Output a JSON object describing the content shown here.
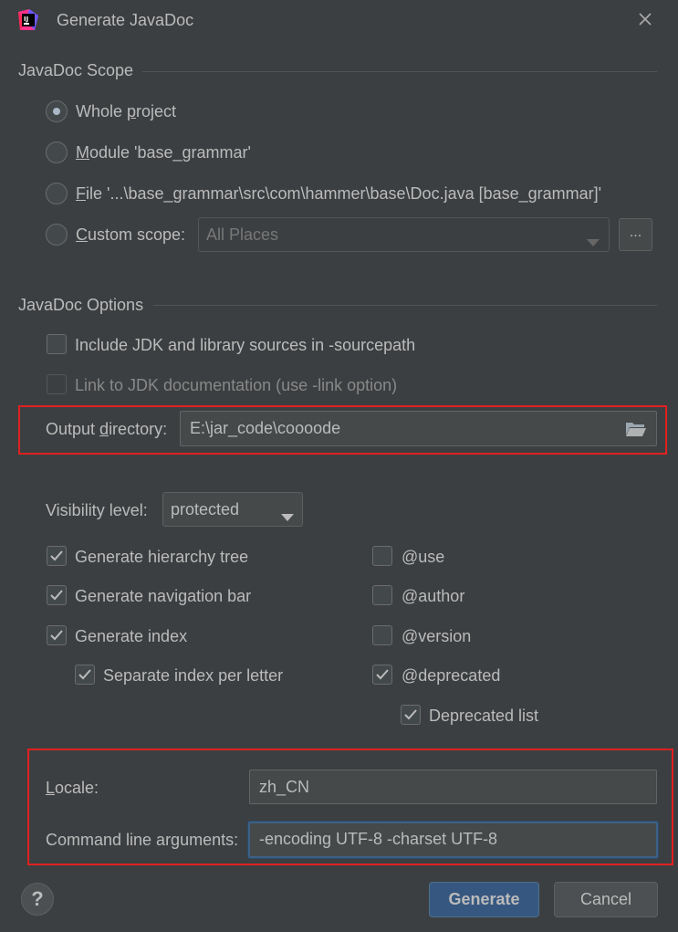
{
  "window": {
    "title": "Generate JavaDoc",
    "logo_icon": "intellij-idea-icon",
    "close_icon": "close-icon"
  },
  "scope": {
    "heading": "JavaDoc Scope",
    "whole_project": {
      "pre": "Whole ",
      "u": "p",
      "post": "roject",
      "selected": true
    },
    "module": {
      "pre": "",
      "u": "M",
      "post": "odule 'base_grammar'",
      "selected": false
    },
    "file": {
      "pre": "",
      "u": "F",
      "post": "ile '...\\base_grammar\\src\\com\\hammer\\base\\Doc.java [base_grammar]'",
      "selected": false
    },
    "custom": {
      "pre": "",
      "u": "C",
      "post": "ustom scope:",
      "selected": false
    },
    "custom_combo_value": "All Places",
    "browse_label": "..."
  },
  "options": {
    "heading": "JavaDoc Options",
    "include_jdk": {
      "label": "Include JDK and library sources in -sourcepath",
      "checked": false
    },
    "link_jdk": {
      "label": "Link to JDK documentation (use -link option)",
      "checked": false,
      "disabled": true
    },
    "output_dir": {
      "pre": "Output ",
      "u": "d",
      "post": "irectory:",
      "value": "E:\\jar_code\\coooode",
      "icon": "folder-icon"
    },
    "visibility": {
      "label": "Visibility level:",
      "value": "protected"
    },
    "hierarchy": {
      "label": "Generate hierarchy tree",
      "checked": true
    },
    "navbar": {
      "label": "Generate navigation bar",
      "checked": true
    },
    "index": {
      "label": "Generate index",
      "checked": true
    },
    "sep_index": {
      "label": "Separate index per letter",
      "checked": true
    },
    "use": {
      "label": "@use",
      "checked": false
    },
    "author": {
      "label": "@author",
      "checked": false
    },
    "version": {
      "label": "@version",
      "checked": false
    },
    "deprecated": {
      "label": "@deprecated",
      "checked": true
    },
    "deprecated_list": {
      "label": "Deprecated list",
      "checked": true
    }
  },
  "bottom": {
    "locale": {
      "u": "L",
      "post": "ocale:",
      "value": "zh_CN"
    },
    "cmdline": {
      "label": "Command line arguments:",
      "value": "-encoding UTF-8 -charset UTF-8"
    }
  },
  "buttons": {
    "help_label": "?",
    "generate_label": "Generate",
    "cancel_label": "Cancel"
  },
  "colors": {
    "background": "#3c3f41",
    "text": "#bbbbbb",
    "primary_button": "#365880",
    "highlight_border": "#e02020"
  }
}
